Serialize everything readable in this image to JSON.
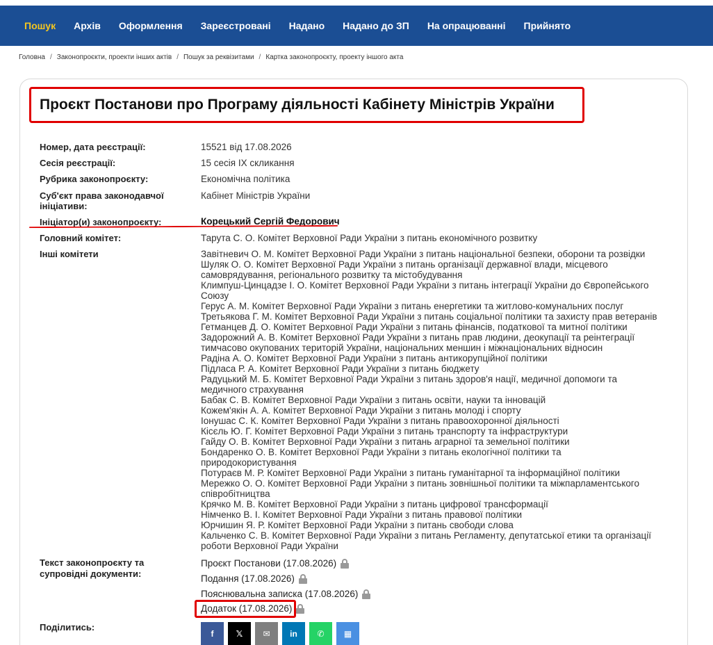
{
  "nav": {
    "items": [
      "Пошук",
      "Архів",
      "Оформлення",
      "Зареєстровані",
      "Надано",
      "Надано до ЗП",
      "На опрацюванні",
      "Прийнято"
    ],
    "active_color": "#f4c61f",
    "bg_color": "#1b4e94"
  },
  "breadcrumbs": [
    "Головна",
    "Законопроєкти, проекти інших актів",
    "Пошук за реквізитами",
    "Картка законопроєкту, проекту іншого акта"
  ],
  "bill": {
    "title": "Проєкт Постанови про Програму діяльності Кабінету Міністрів України",
    "fields": {
      "number_label": "Номер, дата реєстрації:",
      "number_value": "15521 від 17.08.2026",
      "session_label": "Сесія реєстрації:",
      "session_value": "15 сесія IX скликання",
      "rubric_label": "Рубрика законопроєкту:",
      "rubric_value": "Економічна політика",
      "subject_label_1": "Суб'єкт права законодавчої",
      "subject_label_2": "ініціативи:",
      "subject_value": "Кабінет Міністрів України",
      "initiator_label": "Ініціатор(и) законопроєкту:",
      "initiator_value": "Корецький Сергій Федорович",
      "main_committee_label": "Головний комітет:",
      "main_committee_value": "Тарута С. О. Комітет Верховної Ради України з питань економічного розвитку",
      "other_committees_label": "Інші комітети",
      "texts_label_1": "Текст законопроєкту та",
      "texts_label_2": "супровідні документи:",
      "share_label": "Поділитись:"
    },
    "other_committees": [
      "Завітневич О. М. Комітет Верховної Ради України з питань національної безпеки, оборони та розвідки",
      "Шуляк О. О. Комітет Верховної Ради України з питань організації державної влади, місцевого самоврядування, регіонального розвитку та містобудування",
      "Климпуш-Цинцадзе І. О. Комітет Верховної Ради України з питань інтеграції України до Європейського Союзу",
      "Герус А. М. Комітет Верховної Ради України з питань енергетики та житлово-комунальних послуг",
      "Третьякова Г. М. Комітет Верховної Ради України з питань соціальної політики та захисту прав ветеранів",
      "Гетманцев Д. О. Комітет Верховної Ради України з питань фінансів, податкової та митної політики",
      "Задорожний А. В. Комітет Верховної Ради України з питань прав людини, деокупації та реінтеграції тимчасово окупованих територій України, національних меншин і міжнаціональних відносин",
      "Радіна А. О. Комітет Верховної Ради України з питань антикорупційної політики",
      "Підласа Р. А. Комітет Верховної Ради України з питань бюджету",
      "Радуцький М. Б. Комітет Верховної Ради України з питань здоров'я нації, медичної допомоги та медичного страхування",
      "Бабак С. В. Комітет Верховної Ради України з питань освіти, науки та інновацій",
      "Кожем'якін А. А. Комітет Верховної Ради України з питань молоді і спорту",
      "Іонушас С. К. Комітет Верховної Ради України з питань правоохоронної діяльності",
      "Кісєль Ю. Г. Комітет Верховної Ради України з питань транспорту та інфраструктури",
      "Гайду О. В. Комітет Верховної Ради України з питань аграрної та земельної політики",
      "Бондаренко О. В. Комітет Верховної Ради України з питань екологічної політики та природокористування",
      "Потураєв М. Р. Комітет Верховної Ради України з питань гуманітарної та інформаційної політики",
      "Мережко О. О. Комітет Верховної Ради України з питань зовнішньої політики та міжпарламентського співробітництва",
      "Крячко М. В. Комітет Верховної Ради України з питань цифрової трансформації",
      "Німченко В. І. Комітет Верховної Ради України з питань правової політики",
      "Юрчишин Я. Р. Комітет Верховної Ради України з питань свободи слова",
      "Кальченко С. В. Комітет Верховної Ради України з питань Регламенту, депутатської етики та організації роботи Верховної Ради України"
    ],
    "documents": [
      "Проєкт Постанови (17.08.2026)",
      "Подання (17.08.2026)",
      "Пояснювальна записка (17.08.2026)",
      "Додаток (17.08.2026)"
    ],
    "share_buttons": [
      {
        "name": "facebook",
        "glyph": "f",
        "color": "#3b5998"
      },
      {
        "name": "x",
        "glyph": "𝕏",
        "color": "#000000"
      },
      {
        "name": "email",
        "glyph": "✉",
        "color": "#7f7f7f"
      },
      {
        "name": "linkedin",
        "glyph": "in",
        "color": "#0077b5"
      },
      {
        "name": "whatsapp",
        "glyph": "✆",
        "color": "#25d366"
      },
      {
        "name": "qr",
        "glyph": "▦",
        "color": "#4a90e2"
      }
    ]
  }
}
